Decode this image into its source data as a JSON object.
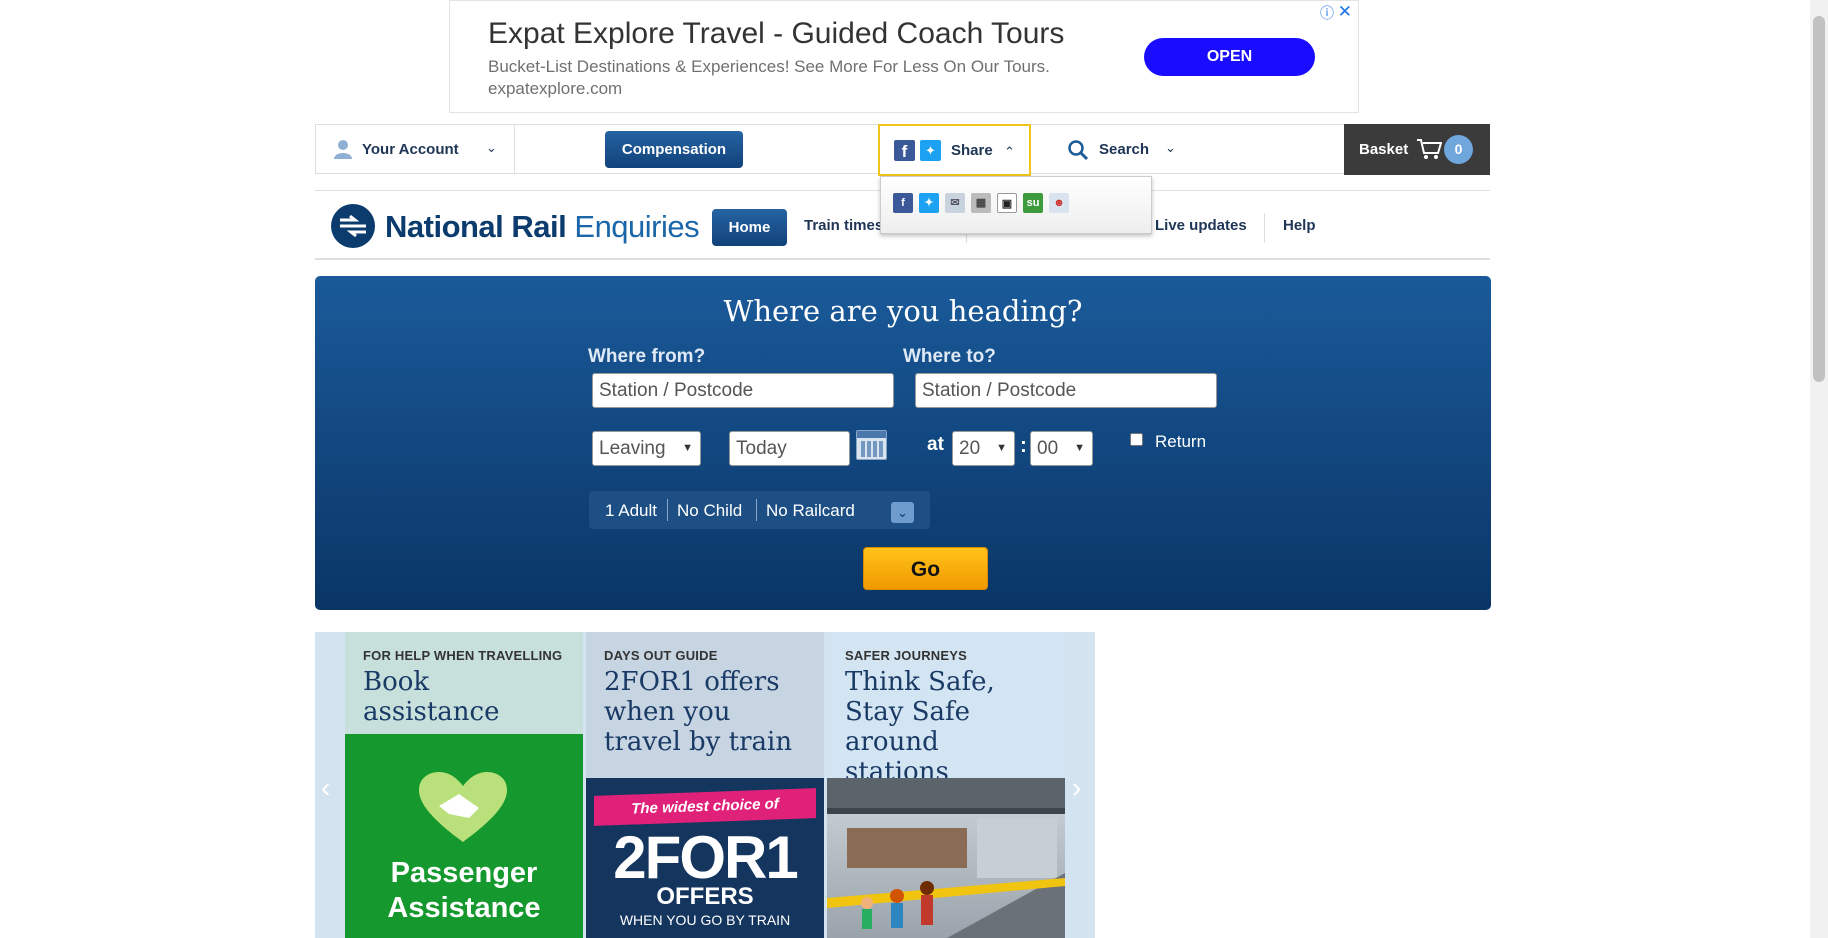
{
  "ad": {
    "title": "Expat Explore Travel - Guided Coach Tours",
    "description": "Bucket-List Destinations & Experiences! See More For Less On Our Tours.",
    "domain": "expatexplore.com",
    "cta": "OPEN",
    "info_icon": "ⓘ",
    "close_icon": "✕"
  },
  "topbar": {
    "account_label": "Your Account",
    "compensation_label": "Compensation",
    "share_label": "Share",
    "search_label": "Search",
    "basket_label": "Basket",
    "basket_count": "0"
  },
  "share_menu": {
    "icons": [
      "facebook-icon",
      "twitter-icon",
      "email-icon",
      "delicious-icon",
      "digg-icon",
      "stumbleupon-icon",
      "reddit-icon"
    ]
  },
  "nav": {
    "brand_bold": "National Rail",
    "brand_light": "Enquiries",
    "items": [
      {
        "label": "Home"
      },
      {
        "label": "Train times"
      },
      {
        "label": "Live updates"
      },
      {
        "label": "Help"
      }
    ]
  },
  "planner": {
    "title": "Where are you heading?",
    "from_label": "Where from?",
    "to_label": "Where to?",
    "from_placeholder": "Station / Postcode",
    "to_placeholder": "Station / Postcode",
    "leaving_value": "Leaving",
    "date_value": "Today",
    "at_label": "at",
    "hour_value": "20",
    "minute_value": "00",
    "return_label": "Return",
    "passengers": {
      "adults": "1 Adult",
      "children": "No Child",
      "railcard": "No Railcard"
    },
    "go_label": "Go"
  },
  "carousel": {
    "cards": [
      {
        "kicker": "FOR HELP WHEN TRAVELLING",
        "title": "Book assistance",
        "image_text": "Passenger Assistance"
      },
      {
        "kicker": "DAYS OUT GUIDE",
        "title": "2FOR1 offers when you travel by train",
        "image_banner": "The widest choice of",
        "image_big": "2FOR1",
        "image_offers": "OFFERS",
        "image_sub": "WHEN YOU GO BY TRAIN"
      },
      {
        "kicker": "SAFER JOURNEYS",
        "title": "Think Safe, Stay Safe around stations"
      }
    ]
  },
  "colors": {
    "brand_navy": "#0c3b6e",
    "planner_top": "#1a5a9a",
    "planner_bottom": "#0a3566",
    "go_yellow": "#ffc21a",
    "basket_bg": "#3b3b3b",
    "ad_open_blue": "#1a0dff"
  }
}
